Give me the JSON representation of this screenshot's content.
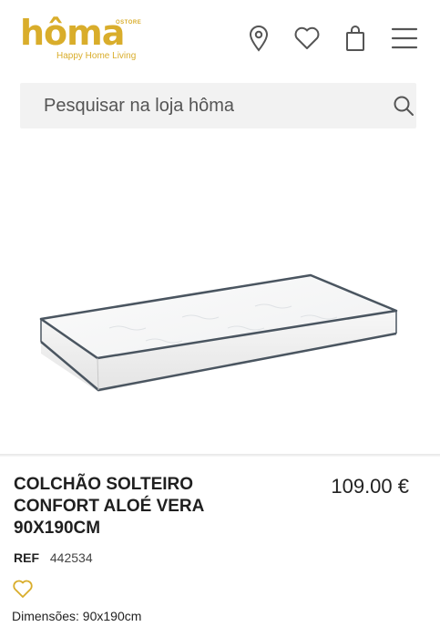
{
  "header": {
    "logo": {
      "wordmark": "hôma",
      "ostore": "OSTORE",
      "tagline": "Happy Home Living"
    },
    "icons": [
      "location-icon",
      "heart-icon",
      "bag-icon",
      "menu-icon"
    ]
  },
  "search": {
    "placeholder": "Pesquisar na loja hôma"
  },
  "product": {
    "title": "COLCHÃO SOLTEIRO CONFORT ALOÉ VERA 90X190CM",
    "price": "109.00 €",
    "ref_label": "REF",
    "ref_value": "442534",
    "dimensions": "Dimensões: 90x190cm"
  },
  "colors": {
    "brand": "#d9ad2b",
    "search_bg": "#f2f2f2",
    "mattress_edge": "#4a5560"
  }
}
